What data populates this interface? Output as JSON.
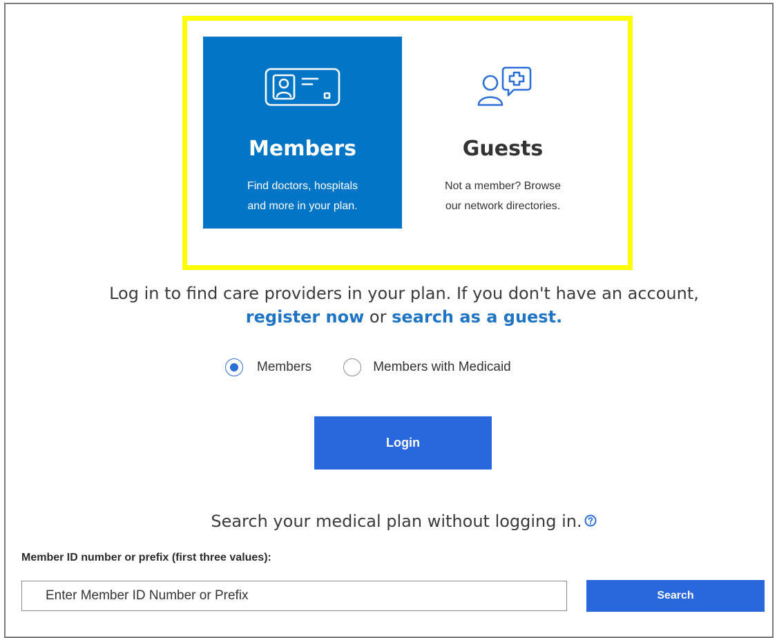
{
  "cards": {
    "members": {
      "title": "Members",
      "description": "Find doctors, hospitals\nand more in your plan.",
      "icon": "member-id-card-icon",
      "background": "#0275c6"
    },
    "guests": {
      "title": "Guests",
      "description": "Not a member? Browse\nour network directories.",
      "icon": "guest-person-chat-icon"
    }
  },
  "intro": {
    "text_before": "Log in to find care providers in your plan. If you don't have an account, ",
    "register_link": "register now",
    "text_middle": " or ",
    "guest_link": "search as a guest."
  },
  "plan_type": {
    "options": [
      {
        "label": "Members",
        "selected": true
      },
      {
        "label": "Members with Medicaid",
        "selected": false
      }
    ]
  },
  "login": {
    "label": "Login"
  },
  "search": {
    "heading": "Search your medical plan without logging in.",
    "help_icon": "question-circle-icon",
    "field_label": "Member ID number or prefix (first three values):",
    "placeholder": "Enter Member ID Number or Prefix",
    "button_label": "Search"
  },
  "colors": {
    "accent": "#2868dc",
    "link": "#1f74c4",
    "highlight": "#ffff00"
  }
}
